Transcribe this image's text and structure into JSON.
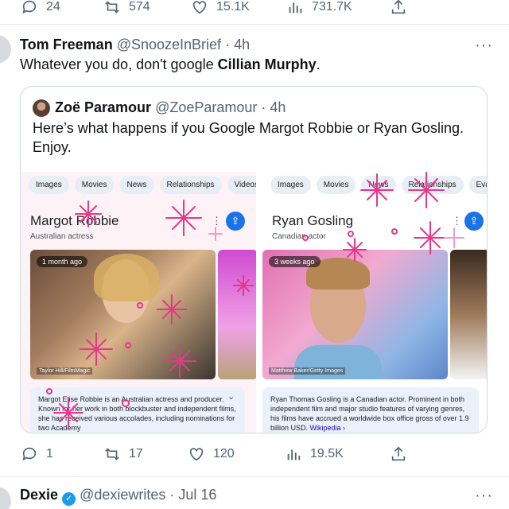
{
  "top_actions": {
    "reply": "24",
    "retweet": "574",
    "like": "15.1K",
    "views": "731.7K"
  },
  "tweet": {
    "author_name": "Tom Freeman",
    "handle": "@SnoozeInBrief",
    "time": "· 4h",
    "text_prefix": "Whatever you do, don't google ",
    "text_bold": "Cillian Murphy",
    "text_suffix": ".",
    "more": "···"
  },
  "quote": {
    "author_name": "Zoë Paramour",
    "handle": "@ZoeParamour",
    "time": "· 4h",
    "text": "Here’s what happens if you Google Margot Robbie or Ryan Gosling. Enjoy.",
    "left": {
      "chips": [
        "Images",
        "Movies",
        "News",
        "Relationships",
        "Videos"
      ],
      "name": "Margot Robbie",
      "subtitle": "Australian actress",
      "badge": "1 month ago",
      "credit": "Taylor Hill/FilmMagic",
      "summary": "Margot Elise Robbie is an Australian actress and producer. Known for her work in both blockbuster and independent films, she has received various accolades, including nominations for two Academy"
    },
    "right": {
      "chips": [
        "Images",
        "Movies",
        "News",
        "Relationships",
        "Eva Mendes"
      ],
      "name": "Ryan Gosling",
      "subtitle": "Canadian actor",
      "badge": "3 weeks ago",
      "credit": "Matthew Baker/Getty Images",
      "summary": "Ryan Thomas Gosling is a Canadian actor. Prominent in both independent film and major studio features of varying genres, his films have accrued a worldwide box office gross of over 1.9 billion USD.",
      "link": "Wikipedia ›"
    }
  },
  "bottom_actions": {
    "reply": "1",
    "retweet": "17",
    "like": "120",
    "views": "19.5K"
  },
  "next_tweet": {
    "author_name": "Dexie",
    "handle": "@dexiewrites",
    "time": "· Jul 16",
    "more": "···"
  },
  "colors": {
    "sparkle": "#e8378a",
    "link": "#1a0dab",
    "verified": "#1d9bf0"
  }
}
